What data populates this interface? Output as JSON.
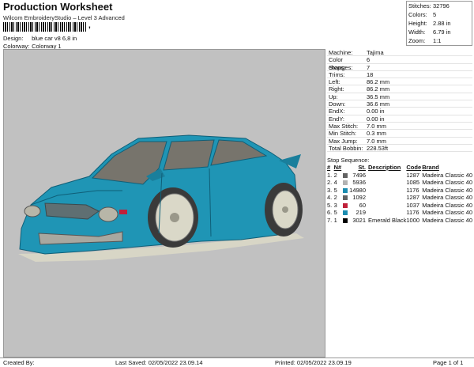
{
  "header": {
    "title": "Production Worksheet",
    "software": "Wilcom EmbroideryStudio – Level 3 Advanced",
    "barcode_text": ",",
    "design_label": "Design:",
    "design_value": "blue car v8 6,8 in",
    "colorway_label": "Colorway:",
    "colorway_value": "Colorway 1"
  },
  "summary": [
    {
      "label": "Stitches:",
      "value": "32796"
    },
    {
      "label": "Colors:",
      "value": "5"
    },
    {
      "label": "Height:",
      "value": "2.88 in"
    },
    {
      "label": "Width:",
      "value": "6.79 in"
    },
    {
      "label": "Zoom:",
      "value": "1:1"
    }
  ],
  "machine_info": [
    {
      "label": "Machine:",
      "value": "Tajima"
    },
    {
      "label": "Color changes:",
      "value": "6"
    },
    {
      "label": "Stops:",
      "value": "7"
    },
    {
      "label": "Trims:",
      "value": "18"
    },
    {
      "label": "Left:",
      "value": "86.2 mm"
    },
    {
      "label": "Right:",
      "value": "86.2 mm"
    },
    {
      "label": "Up:",
      "value": "36.5 mm"
    },
    {
      "label": "Down:",
      "value": "36.6 mm"
    },
    {
      "label": "EndX:",
      "value": "0.00 in"
    },
    {
      "label": "EndY:",
      "value": "0.00 in"
    },
    {
      "label": "Max Stitch:",
      "value": "7.0 mm"
    },
    {
      "label": "Min Stitch:",
      "value": "0.3 mm"
    },
    {
      "label": "Max Jump:",
      "value": "7.0 mm"
    },
    {
      "label": "Total Bobbin:",
      "value": "228.53ft"
    }
  ],
  "stop_sequence": {
    "title": "Stop Sequence:",
    "headers": [
      "#",
      "N#",
      "",
      "St.",
      "Description",
      "Code",
      "Brand"
    ],
    "rows": [
      {
        "stop": "1.",
        "n": "2",
        "color": "#636363",
        "st": "7496",
        "desc": "",
        "code": "1287",
        "brand": "Madeira Classic 40"
      },
      {
        "stop": "2.",
        "n": "4",
        "color": "#b2b2b2",
        "st": "5936",
        "desc": "",
        "code": "1085",
        "brand": "Madeira Classic 40"
      },
      {
        "stop": "3.",
        "n": "5",
        "color": "#1c8cb0",
        "st": "14980",
        "desc": "",
        "code": "1176",
        "brand": "Madeira Classic 40"
      },
      {
        "stop": "4.",
        "n": "2",
        "color": "#636363",
        "st": "1092",
        "desc": "",
        "code": "1287",
        "brand": "Madeira Classic 40"
      },
      {
        "stop": "5.",
        "n": "3",
        "color": "#c0203a",
        "st": "60",
        "desc": "",
        "code": "1037",
        "brand": "Madeira Classic 40"
      },
      {
        "stop": "6.",
        "n": "5",
        "color": "#1c8cb0",
        "st": "219",
        "desc": "",
        "code": "1176",
        "brand": "Madeira Classic 40"
      },
      {
        "stop": "7.",
        "n": "1",
        "color": "#000000",
        "st": "3021",
        "desc": "Emerald Black",
        "code": "1000",
        "brand": "Madeira Classic 40"
      }
    ]
  },
  "footer": {
    "created_by": "Created By:",
    "last_saved": "Last Saved: 02/05/2022 23.09.14",
    "printed": "Printed: 02/05/2022 23.09.19",
    "page": "Page 1 of 1"
  },
  "colors": {
    "body": "#1f95b5",
    "glass": "#77746c",
    "rim": "#dad8c8",
    "tire": "#3a3a3a",
    "canvas": "#c1c1c1"
  }
}
